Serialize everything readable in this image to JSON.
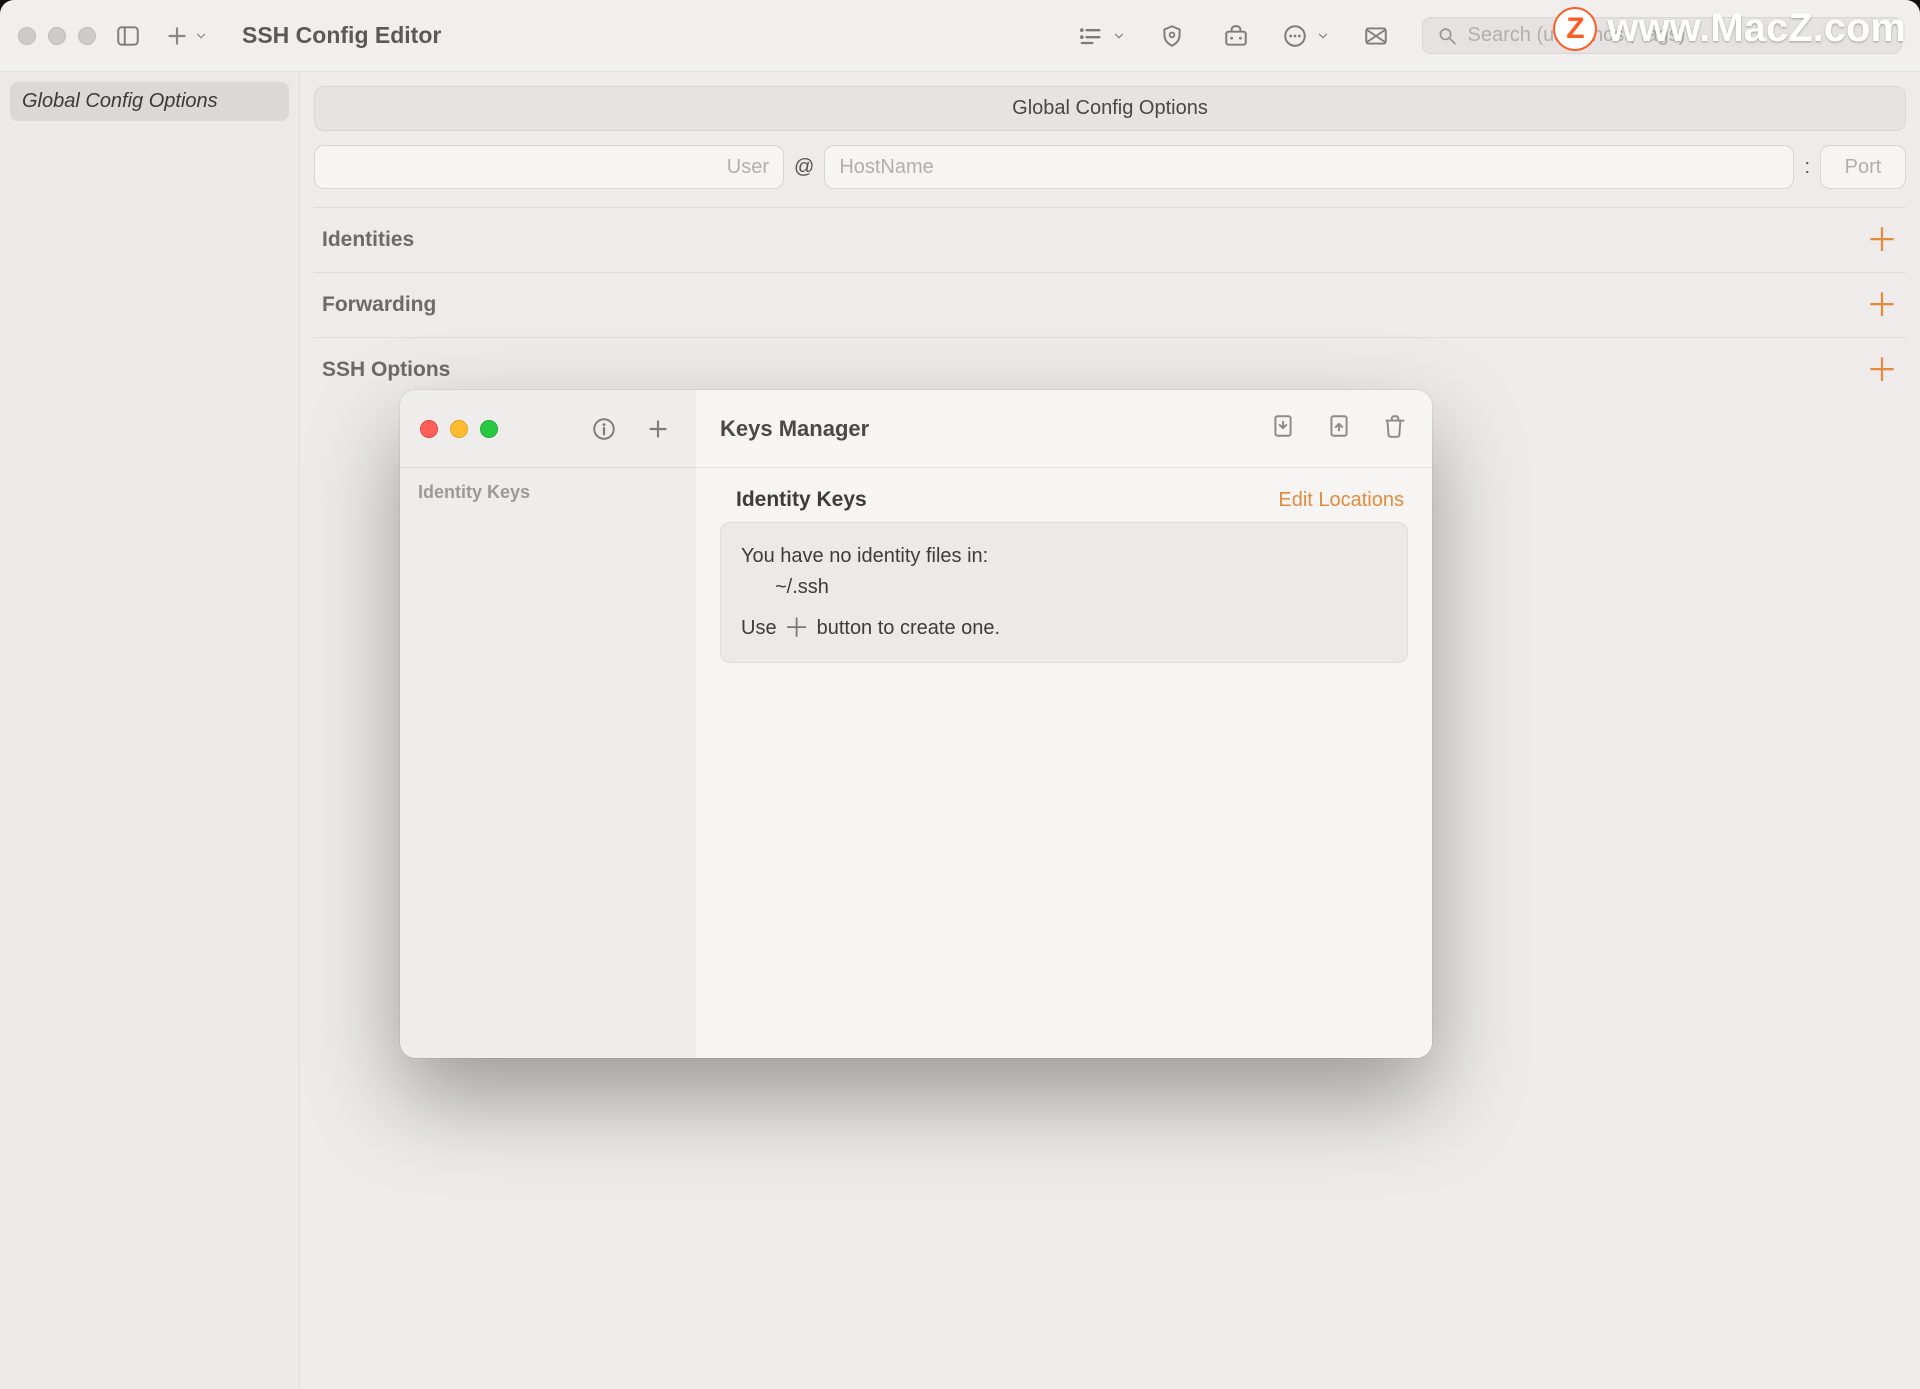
{
  "app": {
    "title": "SSH Config Editor",
    "search_placeholder": "Search (user, host, tags)"
  },
  "sidebar": {
    "items": [
      {
        "label": "Global Config Options"
      }
    ]
  },
  "main": {
    "header_label": "Global Config Options",
    "user_placeholder": "User",
    "at_symbol": "@",
    "host_placeholder": "HostName",
    "colon_symbol": ":",
    "port_placeholder": "Port",
    "sections": [
      {
        "title": "Identities"
      },
      {
        "title": "Forwarding"
      },
      {
        "title": "SSH Options"
      }
    ]
  },
  "modal": {
    "title": "Keys Manager",
    "sidebar_label": "Identity Keys",
    "section_title": "Identity Keys",
    "edit_locations_label": "Edit Locations",
    "empty_line1": "You have no identity files in:",
    "empty_path": "~/.ssh",
    "empty_use_prefix": "Use",
    "empty_use_suffix": "button to create one."
  },
  "watermark": {
    "badge": "Z",
    "url": "www.MacZ.com"
  }
}
